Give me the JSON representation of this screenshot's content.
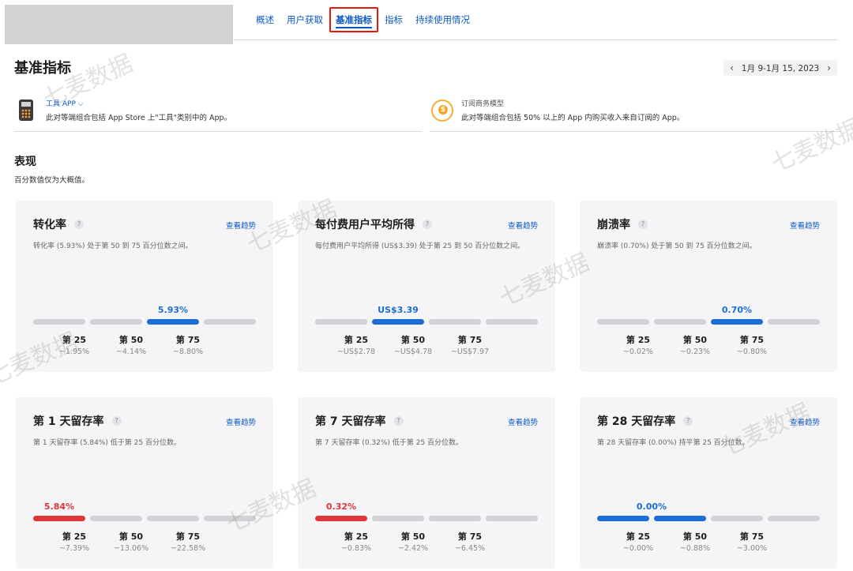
{
  "nav": {
    "tabs": [
      {
        "label": "概述"
      },
      {
        "label": "用户获取"
      },
      {
        "label": "基准指标"
      },
      {
        "label": "指标"
      },
      {
        "label": "持续使用情况"
      }
    ],
    "active_tab_index": 2
  },
  "page": {
    "title": "基准指标",
    "date_range": "1月 9-1月 15, 2023",
    "prev_icon": "chevron-left-icon",
    "next_icon": "chevron-right-icon"
  },
  "peer_groups": [
    {
      "icon": "calculator-icon",
      "title": "工具 APP ⌵",
      "description": "此对等端组合包括 App Store 上\"工具\"类别中的 App。"
    },
    {
      "icon": "subscription-icon",
      "title": "订阅商务模型",
      "description": "此对等端组合包括 50% 以上的 App 内购买收入来自订阅的 App。"
    }
  ],
  "section": {
    "title": "表现",
    "note": "百分数值仅为大概值。"
  },
  "colors": {
    "accent": "#0a58c8",
    "bar_blue": "#1b6ed4",
    "bar_red": "#e0363a",
    "bar_gray": "#d1d1d6",
    "highlight_border": "#e8180c"
  },
  "trend_label": "查看趋势",
  "help_glyph": "?",
  "cards": [
    {
      "name": "转化率",
      "description": "转化率 (5.93%) 处于第 50 到 75 百分位数之间。",
      "value": "5.93%",
      "value_color": "blue",
      "position_segment": 2,
      "percentiles": [
        {
          "label": "第 25",
          "value": "~1.95%"
        },
        {
          "label": "第 50",
          "value": "~4.14%"
        },
        {
          "label": "第 75",
          "value": "~8.80%"
        }
      ]
    },
    {
      "name": "每付费用户平均所得",
      "description": "每付费用户平均所得 (US$3.39) 处于第 25 到 50 百分位数之间。",
      "value": "US$3.39",
      "value_color": "blue",
      "position_segment": 1,
      "percentiles": [
        {
          "label": "第 25",
          "value": "~US$2.78"
        },
        {
          "label": "第 50",
          "value": "~US$4.78"
        },
        {
          "label": "第 75",
          "value": "~US$7.97"
        }
      ]
    },
    {
      "name": "崩溃率",
      "description": "崩溃率 (0.70%) 处于第 50 到 75 百分位数之间。",
      "value": "0.70%",
      "value_color": "blue",
      "position_segment": 2,
      "percentiles": [
        {
          "label": "第 25",
          "value": "~0.02%"
        },
        {
          "label": "第 50",
          "value": "~0.23%"
        },
        {
          "label": "第 75",
          "value": "~0.80%"
        }
      ]
    },
    {
      "name": "第 1 天留存率",
      "description": "第 1 天留存率 (5.84%) 低于第 25 百分位数。",
      "value": "5.84%",
      "value_color": "red",
      "position_segment": 0,
      "percentiles": [
        {
          "label": "第 25",
          "value": "~7.39%"
        },
        {
          "label": "第 50",
          "value": "~13.06%"
        },
        {
          "label": "第 75",
          "value": "~22.58%"
        }
      ]
    },
    {
      "name": "第 7 天留存率",
      "description": "第 7 天留存率 (0.32%) 低于第 25 百分位数。",
      "value": "0.32%",
      "value_color": "red",
      "position_segment": 0,
      "percentiles": [
        {
          "label": "第 25",
          "value": "~0.83%"
        },
        {
          "label": "第 50",
          "value": "~2.42%"
        },
        {
          "label": "第 75",
          "value": "~6.45%"
        }
      ]
    },
    {
      "name": "第 28 天留存率",
      "description": "第 28 天留存率 (0.00%) 持平第 25 百分位数。",
      "value": "0.00%",
      "value_color": "blue",
      "position_segment": "0-1",
      "percentiles": [
        {
          "label": "第 25",
          "value": "~0.00%"
        },
        {
          "label": "第 50",
          "value": "~0.88%"
        },
        {
          "label": "第 75",
          "value": "~3.00%"
        }
      ]
    }
  ],
  "watermark_text": "七麦数据"
}
